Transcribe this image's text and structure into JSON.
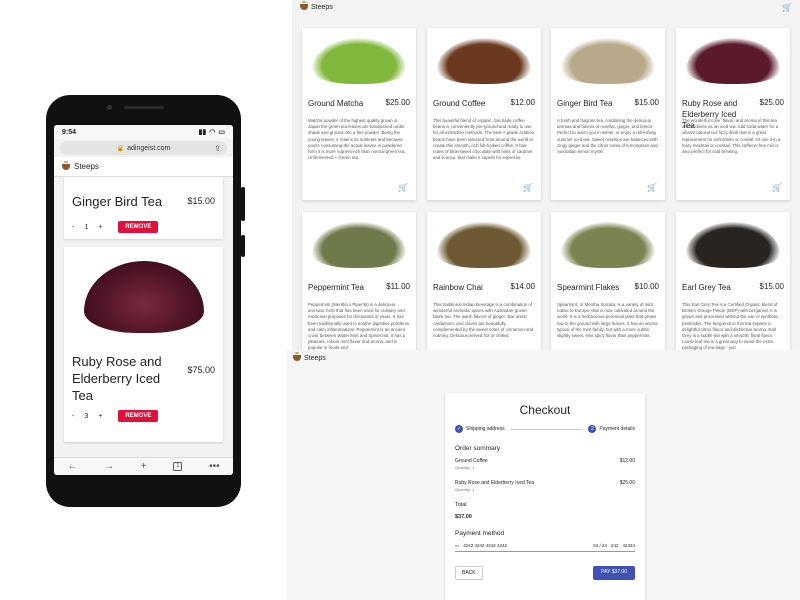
{
  "phone": {
    "time": "9:54",
    "url": "adingeist.com",
    "app_title": "Steeps",
    "items": [
      {
        "name": "Ginger Bird Tea",
        "price": "$15.00",
        "qty": "1",
        "minus": "-",
        "plus": "+",
        "remove": "REMOVE"
      },
      {
        "name": "Ruby Rose and Elderberry Iced Tea",
        "price": "$75.00",
        "qty": "3",
        "minus": "-",
        "plus": "+",
        "remove": "REMOVE"
      }
    ],
    "nav": {
      "back": "←",
      "forward": "→",
      "new_tab": "+",
      "tabs": "1",
      "menu": "•••"
    }
  },
  "grid": {
    "app_title": "Steeps",
    "products": [
      {
        "name": "Ground Matcha",
        "price": "$25.00",
        "color": "#7fb83a",
        "desc": "Matcha powder of the highest quality grown in Japan the green tea leaves are handpicked under shade and ground into a fine powder. Being the young leaves, it retains its nutrients and because you're consuming the actual leaves in powdered form it is more nutrient-rich than normal green tea. Unfermented + Green tea."
      },
      {
        "name": "Ground Coffee",
        "price": "$12.00",
        "color": "#6b3a1e",
        "desc": "This beautiful blend of organic, fair-trade coffee beans is conveniently pre-ground and ready to use for all extraction methods. The best A-grade Arabica beans have been selected from around the world to create this smooth, rich full-bodied coffee. It has notes of bittersweet chocolate with hints of caramel and licorice, that make it superb for espresso."
      },
      {
        "name": "Ginger Bird Tea",
        "price": "$15.00",
        "color": "#b8a98a",
        "desc": "A fresh and fragrant tea, combining the delicious aromas and flavors of rosehip, ginger, and lemon. Perfect to warm you in winter, or enjoy a refreshing summer iced tea. Sweet rosehips are balanced with zingy ginger and the citrus notes of lemongrass and Australian lemon myrtle."
      },
      {
        "name": "Ruby Rose and Elderberry Iced Tea",
        "price": "$25.00",
        "color": "#5a1a2a",
        "desc": "The wonderful color, flavor, and aroma of this tea are as divine as an iced tea. Add soda water for a vibrant natural red fizzy drink that is a great replacement for soft drinks or cordial. Or use it in a fruity mocktail or cocktail. This caffeine-free mix is also perfect for cold brewing."
      },
      {
        "name": "Peppermint Tea",
        "price": "$11.00",
        "color": "#6e7a4a",
        "desc": "Peppermint (Mentha x Piperita) is a delicious aromatic herb that has been used for culinary and medicinal purposes for thousands of years. It has been traditionally used to soothe digestive problems and calm inflammations. Peppermint is an ancient cross between Water Mint and Spearmint. It has a pleasant, robust mint flavor and aroma, and is popular in foods and"
      },
      {
        "name": "Rainbow Chai",
        "price": "$14.00",
        "color": "#6e5a32",
        "desc": "This traditional Indian beverage is a combination of wonderful aromatic spices with Australian-grown black tea. The warm flavors of ginger, star anise, cardamom, and cloves are beautifully complemented by the sweet notes of cinnamon and nutmeg. Delicious served hot or chilled."
      },
      {
        "name": "Spearmint Flakes",
        "price": "$10.00",
        "color": "#7a8450",
        "desc": "Spearmint, or Mentha Spicata, is a variety of mint native to Europe, that is now cultivated around the world. It is a herbaceous perennial plant that grows low to the ground with large leaves. It has an aroma typical of the mint family, but with a more subtle, slightly sweet, less spicy flavor than peppermint."
      },
      {
        "name": "Earl Grey Tea",
        "price": "$15.00",
        "color": "#2a2420",
        "desc": "This Earl Grey Tea is a Certified Organic blend of Broken Orange Pekoe (BOP) with bergamot. It is grown and processed without the use of synthetic pesticides. The bergamot in this tea imparts a delightful citrus flavor and distinctive aroma. Earl Grey is a subtle tea with a smooth, floral flavor. Loose leaf tea is a great way to avoid the extra packaging of tea bags - just"
      }
    ]
  },
  "checkout": {
    "app_title": "Steeps",
    "title": "Checkout",
    "step1": "Shipping address",
    "step2": "Payment details",
    "step2_num": "2",
    "order_summary": "Order summary",
    "items": [
      {
        "name": "Ground Coffee",
        "qty": "Quantity: 1",
        "price": "$12.00"
      },
      {
        "name": "Ruby Rose and Elderberry Iced Tea",
        "qty": "Quantity: 1",
        "price": "$25.00"
      }
    ],
    "total_label": "Total",
    "total": "$37.00",
    "payment_method": "Payment method",
    "card_number": "4242 4242 4242 4242",
    "card_exp": "04 / 24",
    "card_cvc": "242",
    "card_zip": "42424",
    "back": "BACK",
    "pay": "PAY $37.00"
  }
}
